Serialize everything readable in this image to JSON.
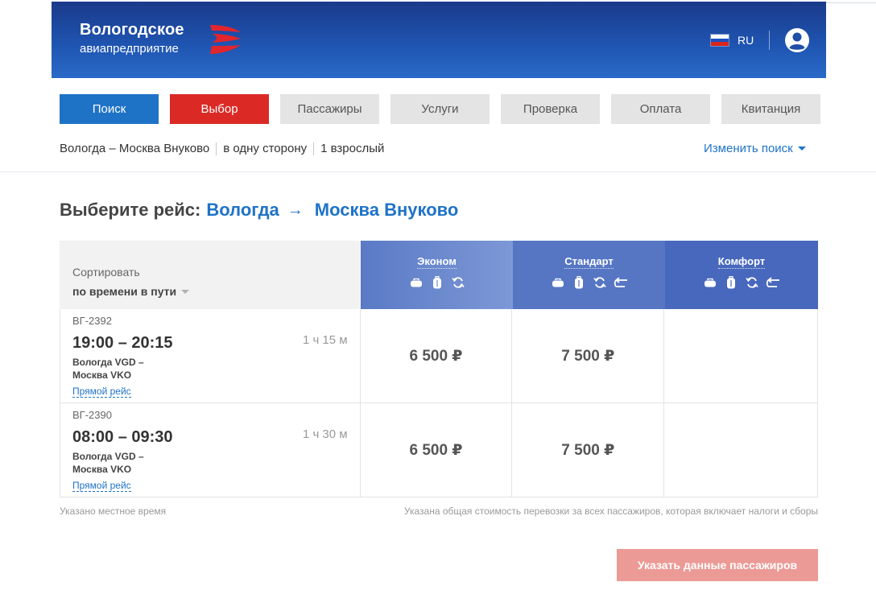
{
  "brand": {
    "title": "Вологодское",
    "subtitle": "авиапредприятие",
    "header_colors": [
      "#1a3a8a",
      "#2a6ac8"
    ],
    "wing_color": "#e1262d"
  },
  "language": {
    "code": "RU",
    "flag_colors": [
      "#ffffff",
      "#1c4fc4",
      "#d9261c"
    ]
  },
  "user_menu": {
    "icon": "user-circle-icon"
  },
  "steps": [
    {
      "label": "Поиск",
      "state": "done"
    },
    {
      "label": "Выбор",
      "state": "active"
    },
    {
      "label": "Пассажиры",
      "state": "pending"
    },
    {
      "label": "Услуги",
      "state": "pending"
    },
    {
      "label": "Проверка",
      "state": "pending"
    },
    {
      "label": "Оплата",
      "state": "pending"
    },
    {
      "label": "Квитанция",
      "state": "pending"
    }
  ],
  "search_summary": {
    "route": "Вологда – Москва Внуково",
    "trip_type": "в одну сторону",
    "passengers": "1 взрослый",
    "change_label": "Изменить поиск"
  },
  "selection": {
    "heading": "Выберите рейс:",
    "from": "Вологда",
    "arrow": "→",
    "to": "Москва Внуково"
  },
  "sort": {
    "label": "Сортировать",
    "value": "по времени в пути"
  },
  "fares": [
    {
      "name": "Эконом",
      "icons": [
        "hand-luggage-icon",
        "baggage-icon",
        "exchange-icon"
      ],
      "color": "#6f8fd0"
    },
    {
      "name": "Стандарт",
      "icons": [
        "hand-luggage-icon",
        "baggage-icon",
        "exchange-icon",
        "refund-icon"
      ],
      "color": "#5676c4"
    },
    {
      "name": "Комфорт",
      "icons": [
        "hand-luggage-icon",
        "baggage-icon",
        "exchange-icon",
        "refund-icon"
      ],
      "color": "#4868bd"
    }
  ],
  "flights": [
    {
      "number": "ВГ-2392",
      "time": "19:00 – 20:15",
      "duration": "1 ч 15 м",
      "route_from": "Вологда VGD –",
      "route_to": "Москва VKO",
      "direct_label": "Прямой рейс",
      "prices": [
        "6 500 ₽",
        "7 500 ₽",
        ""
      ]
    },
    {
      "number": "ВГ-2390",
      "time": "08:00 – 09:30",
      "duration": "1 ч 30 м",
      "route_from": "Вологда VGD –",
      "route_to": "Москва VKO",
      "direct_label": "Прямой рейс",
      "prices": [
        "6 500 ₽",
        "7 500 ₽",
        ""
      ]
    }
  ],
  "notes": {
    "local_time": "Указано местное время",
    "total_cost": "Указана общая стоимость перевозки за всех пассажиров, которая включает налоги и сборы"
  },
  "continue_button": {
    "label": "Указать данные пассажиров",
    "enabled": false
  }
}
